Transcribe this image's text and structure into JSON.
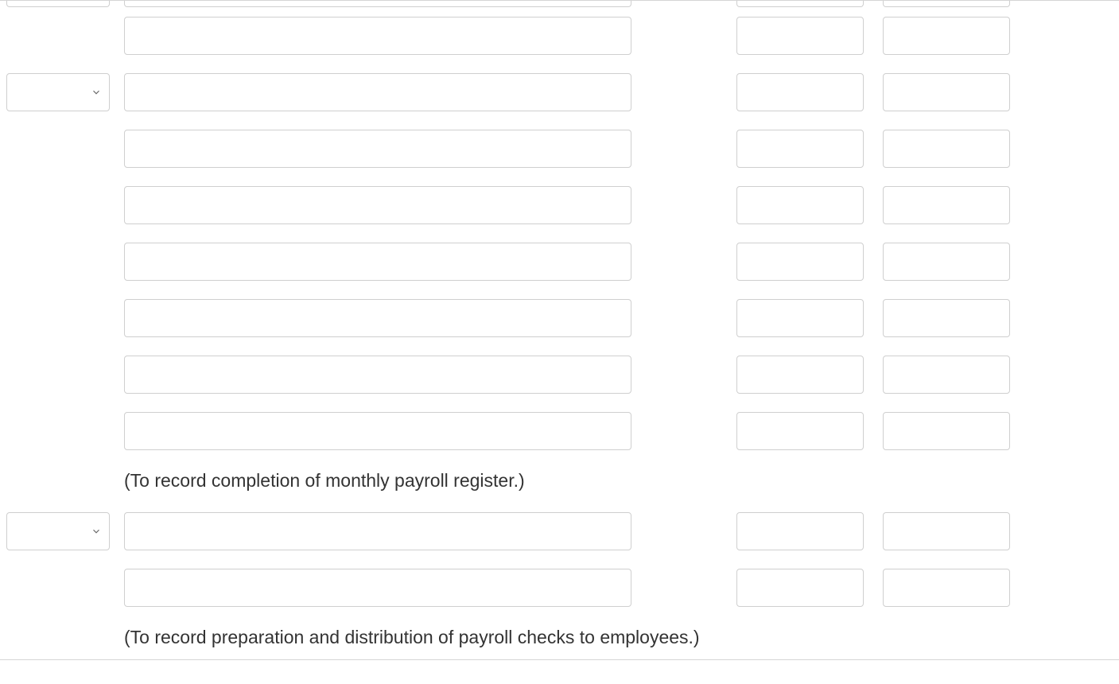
{
  "captions": {
    "first": "(To record completion of monthly payroll register.)",
    "second": "(To record preparation and distribution of payroll checks to employees.)"
  },
  "rows": [
    {
      "hasDate": false,
      "description": "",
      "debit": "",
      "credit": ""
    },
    {
      "hasDate": true,
      "description": "",
      "debit": "",
      "credit": ""
    },
    {
      "hasDate": false,
      "description": "",
      "debit": "",
      "credit": ""
    },
    {
      "hasDate": false,
      "description": "",
      "debit": "",
      "credit": ""
    },
    {
      "hasDate": false,
      "description": "",
      "debit": "",
      "credit": ""
    },
    {
      "hasDate": false,
      "description": "",
      "debit": "",
      "credit": ""
    },
    {
      "hasDate": false,
      "description": "",
      "debit": "",
      "credit": ""
    },
    {
      "hasDate": false,
      "description": "",
      "debit": "",
      "credit": ""
    }
  ],
  "rows2": [
    {
      "hasDate": true,
      "description": "",
      "debit": "",
      "credit": ""
    },
    {
      "hasDate": false,
      "description": "",
      "debit": "",
      "credit": ""
    }
  ]
}
